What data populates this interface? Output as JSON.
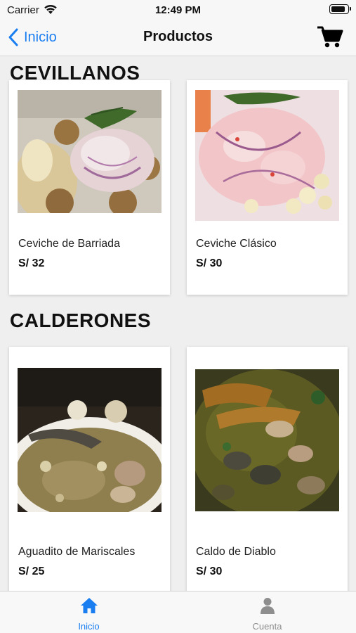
{
  "status_bar": {
    "carrier": "Carrier",
    "time": "12:49 PM",
    "battery_level": 0.9
  },
  "nav": {
    "back_label": "Inicio",
    "title": "Productos",
    "back_icon": "chevron-left-icon",
    "cart_icon": "cart-icon",
    "accent_color": "#1a7ef0"
  },
  "sections": [
    {
      "title": "CEVILLANOS",
      "products": [
        {
          "name": "Ceviche de Barriada",
          "price": "S/ 32"
        },
        {
          "name": "Ceviche Clásico",
          "price": "S/ 30"
        }
      ]
    },
    {
      "title": "CALDERONES",
      "products": [
        {
          "name": "Aguadito de Mariscales",
          "price": "S/ 25"
        },
        {
          "name": "Caldo de Diablo",
          "price": "S/ 30"
        }
      ]
    }
  ],
  "tab_bar": {
    "tabs": [
      {
        "label": "Inicio",
        "icon": "home-icon",
        "active": true
      },
      {
        "label": "Cuenta",
        "icon": "user-icon",
        "active": false
      }
    ],
    "active_color": "#1a7ef0",
    "inactive_color": "#8e8e8e"
  }
}
